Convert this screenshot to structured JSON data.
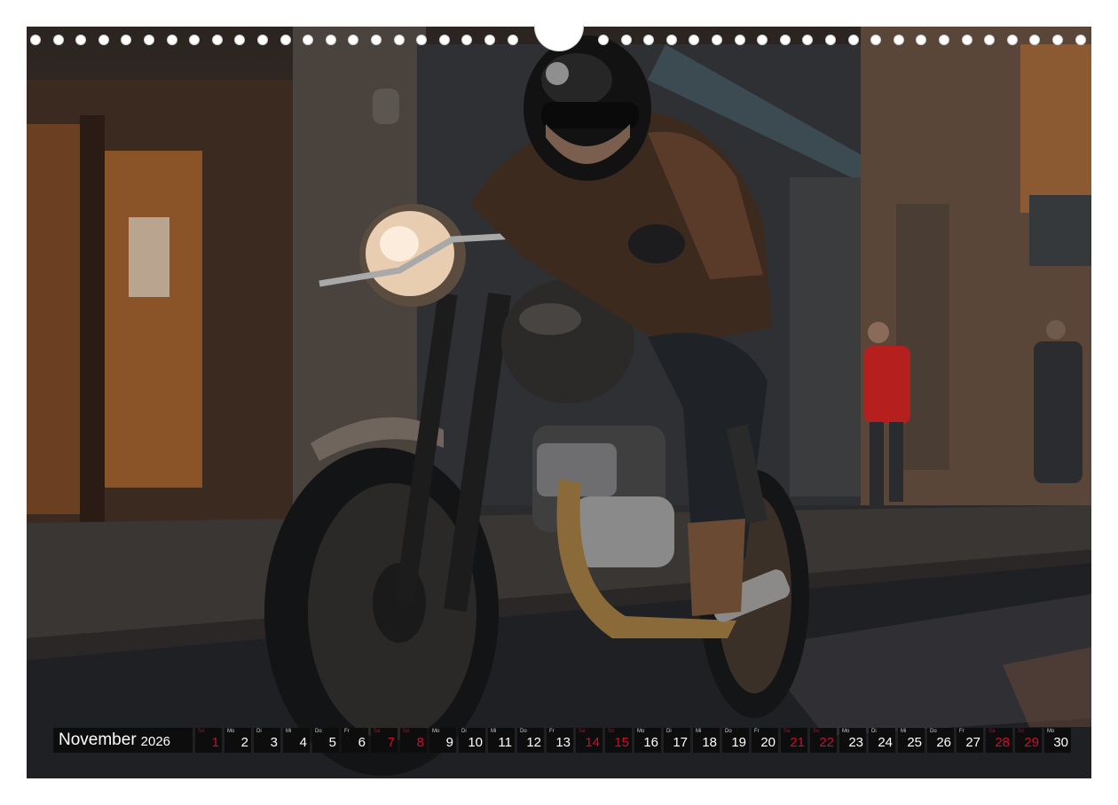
{
  "calendar": {
    "month": "November",
    "year": "2026",
    "days": [
      {
        "abbr": "So",
        "num": "1",
        "weekend": true
      },
      {
        "abbr": "Mo",
        "num": "2",
        "weekend": false
      },
      {
        "abbr": "Di",
        "num": "3",
        "weekend": false
      },
      {
        "abbr": "Mi",
        "num": "4",
        "weekend": false
      },
      {
        "abbr": "Do",
        "num": "5",
        "weekend": false
      },
      {
        "abbr": "Fr",
        "num": "6",
        "weekend": false
      },
      {
        "abbr": "Sa",
        "num": "7",
        "weekend": true
      },
      {
        "abbr": "So",
        "num": "8",
        "weekend": true
      },
      {
        "abbr": "Mo",
        "num": "9",
        "weekend": false
      },
      {
        "abbr": "Di",
        "num": "10",
        "weekend": false
      },
      {
        "abbr": "Mi",
        "num": "11",
        "weekend": false
      },
      {
        "abbr": "Do",
        "num": "12",
        "weekend": false
      },
      {
        "abbr": "Fr",
        "num": "13",
        "weekend": false
      },
      {
        "abbr": "Sa",
        "num": "14",
        "weekend": true
      },
      {
        "abbr": "So",
        "num": "15",
        "weekend": true
      },
      {
        "abbr": "Mo",
        "num": "16",
        "weekend": false
      },
      {
        "abbr": "Di",
        "num": "17",
        "weekend": false
      },
      {
        "abbr": "Mi",
        "num": "18",
        "weekend": false
      },
      {
        "abbr": "Do",
        "num": "19",
        "weekend": false
      },
      {
        "abbr": "Fr",
        "num": "20",
        "weekend": false
      },
      {
        "abbr": "Sa",
        "num": "21",
        "weekend": true
      },
      {
        "abbr": "So",
        "num": "22",
        "weekend": true
      },
      {
        "abbr": "Mo",
        "num": "23",
        "weekend": false
      },
      {
        "abbr": "Di",
        "num": "24",
        "weekend": false
      },
      {
        "abbr": "Mi",
        "num": "25",
        "weekend": false
      },
      {
        "abbr": "Do",
        "num": "26",
        "weekend": false
      },
      {
        "abbr": "Fr",
        "num": "27",
        "weekend": false
      },
      {
        "abbr": "Sa",
        "num": "28",
        "weekend": true
      },
      {
        "abbr": "So",
        "num": "29",
        "weekend": true
      },
      {
        "abbr": "Mo",
        "num": "30",
        "weekend": false
      }
    ]
  },
  "colors": {
    "cell_background": "#0d0d0d",
    "weekday_number": "#ffffff",
    "weekend_number": "#c8102e"
  }
}
